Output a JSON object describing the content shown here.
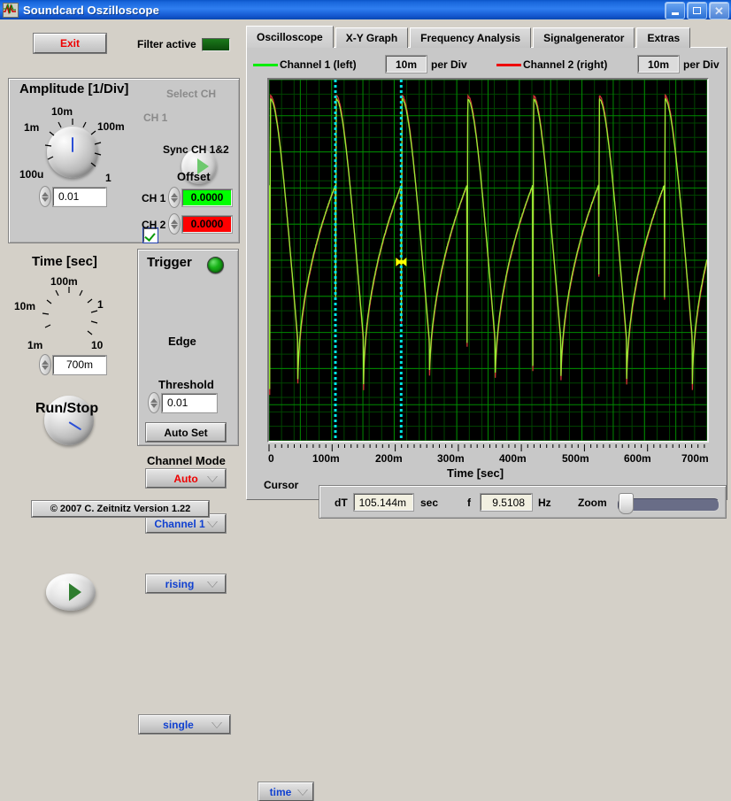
{
  "window": {
    "title": "Soundcard Oszilloscope",
    "icon": "waveform-icon",
    "minimize": "_",
    "maximize": "□",
    "close": "✕"
  },
  "left_panel": {
    "exit_label": "Exit",
    "filter_label": "Filter active",
    "amplitude": {
      "title": "Amplitude [1/Div]",
      "knob_labels": [
        "1m",
        "10m",
        "100m",
        "1",
        "100u"
      ],
      "value": "0.01",
      "select_ch_label": "Select CH",
      "ch_label": "CH 1",
      "sync_label": "Sync CH 1&2",
      "sync_checked": true,
      "offset_title": "Offset",
      "ch1_label": "CH 1",
      "ch1_offset": "0.0000",
      "ch1_color": "#00ff00",
      "ch2_label": "CH 2",
      "ch2_offset": "0.0000",
      "ch2_color": "#ff0000"
    },
    "time": {
      "title": "Time [sec]",
      "knob_labels": [
        "10m",
        "100m",
        "1",
        "10",
        "1m"
      ],
      "value": "700m"
    },
    "trigger": {
      "title": "Trigger",
      "led_on": true,
      "mode": "Auto",
      "channel": "Channel 1",
      "edge_label": "Edge",
      "edge": "rising",
      "threshold_label": "Threshold",
      "threshold": "0.01",
      "auto_set_label": "Auto Set"
    },
    "run_stop": {
      "title": "Run/Stop"
    },
    "channel_mode": {
      "title": "Channel Mode",
      "value": "single"
    },
    "copyright": "© 2007   C. Zeitnitz Version 1.22"
  },
  "tabs": [
    {
      "label": "Oscilloscope",
      "active": true
    },
    {
      "label": "X-Y Graph",
      "active": false
    },
    {
      "label": "Frequency Analysis",
      "active": false
    },
    {
      "label": "Signalgenerator",
      "active": false
    },
    {
      "label": "Extras",
      "active": false
    }
  ],
  "channels": [
    {
      "name": "Channel 1 (left)",
      "color": "#00ee00",
      "enabled": true,
      "per_div_value": "10m",
      "per_div_label": "per Div"
    },
    {
      "name": "Channel 2 (right)",
      "color": "#ee0000",
      "enabled": true,
      "per_div_value": "10m",
      "per_div_label": "per Div"
    }
  ],
  "status_bar": {
    "cursor_label": "Cursor",
    "cursor_mode": "time",
    "dt_label": "dT",
    "dt_value": "105.144m",
    "dt_unit": "sec",
    "f_label": "f",
    "f_value": "9.5108",
    "f_unit": "Hz",
    "zoom_label": "Zoom",
    "zoom_value": 2
  },
  "chart_data": {
    "type": "line",
    "title": "",
    "xlabel": "Time [sec]",
    "ylabel": "",
    "xlim": [
      0,
      0.7
    ],
    "ylim": [
      -0.05,
      0.05
    ],
    "xticks": [
      0,
      0.1,
      0.2,
      0.3,
      0.4,
      0.5,
      0.6,
      0.7
    ],
    "xticklabels": [
      "0",
      "100m",
      "200m",
      "300m",
      "400m",
      "500m",
      "600m",
      "700m"
    ],
    "grid": true,
    "grid_color": "#008a00",
    "minor_grid_color": "#004400",
    "background": "#000000",
    "legend": "top",
    "cursors": {
      "color": "#00e5e5",
      "x": [
        0.1061,
        0.2112
      ],
      "style": "dotted-vertical"
    },
    "marker": {
      "color": "#ffff00",
      "x": 0.2112,
      "y": 0.0
    },
    "period": 0.1051,
    "waveform": "sawtooth-exponential-decay",
    "peaks_x": [
      0.1061,
      0.2112,
      0.3135,
      0.4175,
      0.517,
      0.6192
    ],
    "series": [
      {
        "name": "Channel 1 (left)",
        "color": "#99ee33",
        "peak": 0.037,
        "trough": -0.031
      },
      {
        "name": "Channel 2 (right)",
        "color": "#cc3333",
        "peak": 0.03,
        "trough": -0.025
      }
    ]
  }
}
